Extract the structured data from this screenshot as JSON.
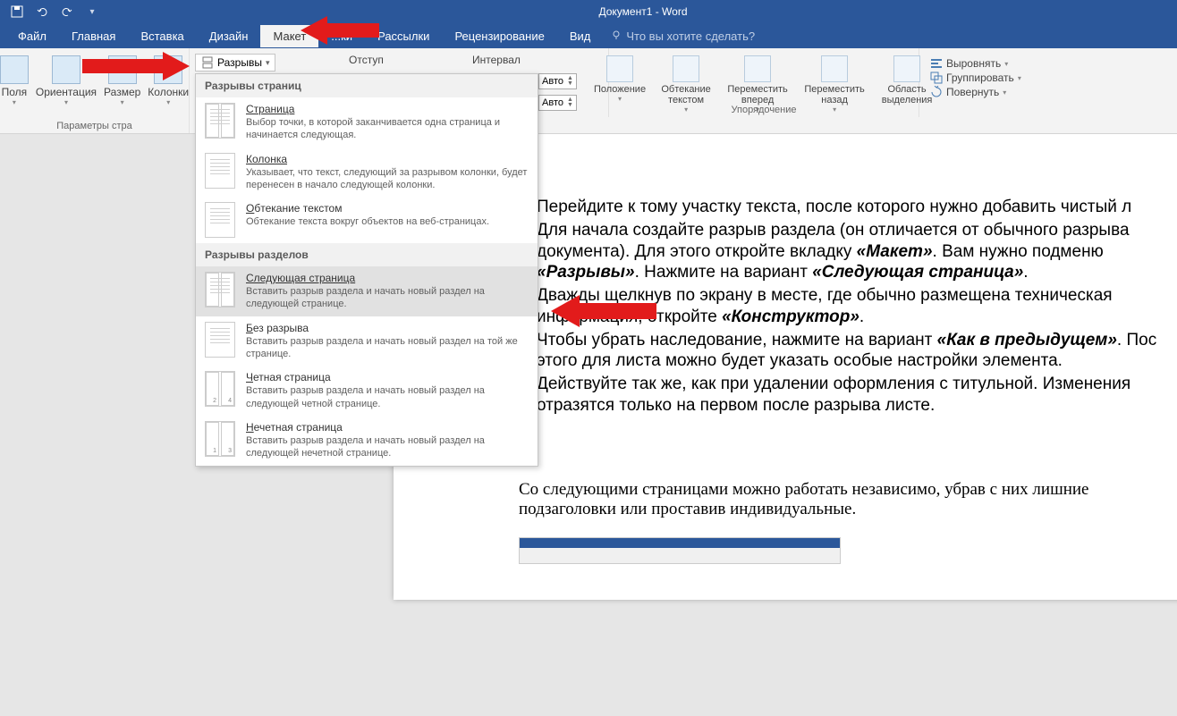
{
  "window": {
    "title": "Документ1 - Word"
  },
  "menutabs": [
    "Файл",
    "Главная",
    "Вставка",
    "Дизайн",
    "Макет",
    "...ки",
    "Рассылки",
    "Рецензирование",
    "Вид"
  ],
  "search_hint": "Что вы хотите сделать?",
  "ribbon": {
    "page_setup": {
      "margins": "Поля",
      "orientation": "Ориентация",
      "size": "Размер",
      "columns": "Колонки",
      "group_label": "Параметры стра",
      "breaks_btn": "Разрывы"
    },
    "indent_label": "Отступ",
    "spacing_label": "Интервал",
    "auto_val": "Авто",
    "arrange": {
      "position": "Положение",
      "wrap": "Обтекание текстом",
      "forward": "Переместить вперед",
      "backward": "Переместить назад",
      "selection": "Область выделения",
      "align": "Выровнять",
      "group": "Группировать",
      "rotate": "Повернуть",
      "group_label": "Упорядочение"
    }
  },
  "dropdown": {
    "sec1": "Разрывы страниц",
    "page": {
      "t": "Страница",
      "d": "Выбор точки, в которой заканчивается одна страница и начинается следующая."
    },
    "column": {
      "t": "Колонка",
      "d": "Указывает, что текст, следующий за разрывом колонки, будет перенесен в начало следующей колонки."
    },
    "textwrap": {
      "t": "Обтекание текстом",
      "d": "Обтекание текста вокруг объектов на веб-страницах."
    },
    "sec2": "Разрывы разделов",
    "nextpage": {
      "t": "Следующая страница",
      "d": "Вставить разрыв раздела и начать новый раздел на следующей странице."
    },
    "continuous": {
      "t": "Без разрыва",
      "d": "Вставить разрыв раздела и начать новый раздел на той же странице."
    },
    "even": {
      "t": "Четная страница",
      "d": "Вставить разрыв раздела и начать новый раздел на следующей четной странице."
    },
    "odd": {
      "t": "Нечетная страница",
      "d": "Вставить разрыв раздела и начать новый раздел на следующей нечетной странице."
    }
  },
  "doc": {
    "li1a": "Перейдите к тому участку текста, после которого нужно добавить чистый л",
    "li2a": "Для начала создайте разрыв раздела (он отличается от обычного разрыва документа). Для этого откройте вкладку ",
    "li2b": "«Макет»",
    "li2c": ". Вам нужно подменю ",
    "li2d": "«Разрывы»",
    "li2e": ". Нажмите на вариант ",
    "li2f": "«Следующая страница»",
    "li2g": ".",
    "li3a": "Дважды щелкнув по экрану в месте, где обычно размещена техническая информация, откройте ",
    "li3b": "«Конструктор»",
    "li3c": ".",
    "li4a": "Чтобы убрать наследование, нажмите на вариант ",
    "li4b": "«Как в предыдущем»",
    "li4c": ". Пос этого для листа можно будет указать особые настройки элемента.",
    "li5a": "Действуйте так же, как при удалении оформления с титульной. Изменения отразятся только на первом после разрыва листе.",
    "para": "Со следующими страницами можно работать независимо, убрав с них лишние подзаголовки или проставив индивидуальные."
  }
}
